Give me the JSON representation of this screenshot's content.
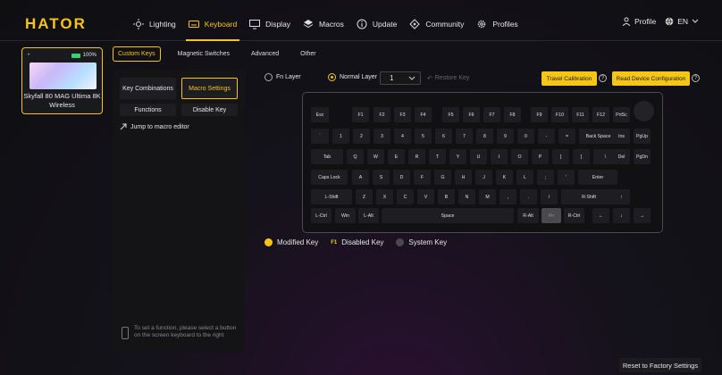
{
  "brand": {
    "logo": "HATOR",
    "accent": "#f5c518"
  },
  "nav": {
    "items": [
      {
        "label": "Lighting",
        "icon": "sun-icon",
        "active": false
      },
      {
        "label": "Keyboard",
        "icon": "keyboard-icon",
        "active": true
      },
      {
        "label": "Display",
        "icon": "monitor-icon",
        "active": false
      },
      {
        "label": "Macros",
        "icon": "macro-icon",
        "active": false
      },
      {
        "label": "Update",
        "icon": "info-icon",
        "active": false
      },
      {
        "label": "Community",
        "icon": "community-icon",
        "active": false
      },
      {
        "label": "Profiles",
        "icon": "gear-icon",
        "active": false
      }
    ],
    "profile_label": "Profile",
    "language": "EN"
  },
  "device": {
    "name": "Skyfall 80 MAG Ultima 8K Wireless",
    "battery": "100%"
  },
  "subtabs": [
    {
      "label": "Custom Keys",
      "active": true
    },
    {
      "label": "Magnetic Switches",
      "active": false
    },
    {
      "label": "Advanced",
      "active": false
    },
    {
      "label": "Other",
      "active": false
    }
  ],
  "panel": {
    "key_combinations": "Key Combinations",
    "macro_settings": "Macro Settings",
    "functions": "Functions",
    "disable_key": "Disable Key",
    "jump_label": "Jump to macro editor",
    "hint": "To set a function, please select a button on the screen keyboard to the right"
  },
  "layers": {
    "fn_layer": "Fn Layer",
    "normal_layer": "Normal Layer",
    "selected_value": "1",
    "restore": "Restore Key",
    "travel_calibration": "Travel Calibration",
    "read_config": "Read Device Configuration"
  },
  "keyboard": {
    "rows": [
      [
        "Esc",
        "F1",
        "F2",
        "F3",
        "F4",
        "F5",
        "F6",
        "F7",
        "F8",
        "F9",
        "F10",
        "F11",
        "F12",
        "PrtSc"
      ],
      [
        "`",
        "1",
        "2",
        "3",
        "4",
        "5",
        "6",
        "7",
        "8",
        "9",
        "0",
        "-",
        "=",
        "Back Space",
        "Ins",
        "PgUp"
      ],
      [
        "Tab",
        "Q",
        "W",
        "E",
        "R",
        "T",
        "Y",
        "U",
        "I",
        "O",
        "P",
        "[",
        "]",
        "\\",
        "Del",
        "PgDn"
      ],
      [
        "Caps Lock",
        "A",
        "S",
        "D",
        "F",
        "G",
        "H",
        "J",
        "K",
        "L",
        ";",
        "'",
        "Enter"
      ],
      [
        "L-Shift",
        "Z",
        "X",
        "C",
        "V",
        "B",
        "N",
        "M",
        ",",
        ".",
        "/",
        "R-Shift",
        "↑"
      ],
      [
        "L-Ctrl",
        "Win",
        "L-Alt",
        "Space",
        "R-Alt",
        "Fn",
        "R-Ctrl",
        "←",
        "↓",
        "→"
      ]
    ]
  },
  "legend": {
    "modified": "Modified Key",
    "modified_color": "#f5c518",
    "disabled_mark": "F1",
    "disabled": "Disabled Key",
    "system": "System Key",
    "system_color": "#4a4a4e"
  },
  "reset_label": "Reset to Factory Settings"
}
